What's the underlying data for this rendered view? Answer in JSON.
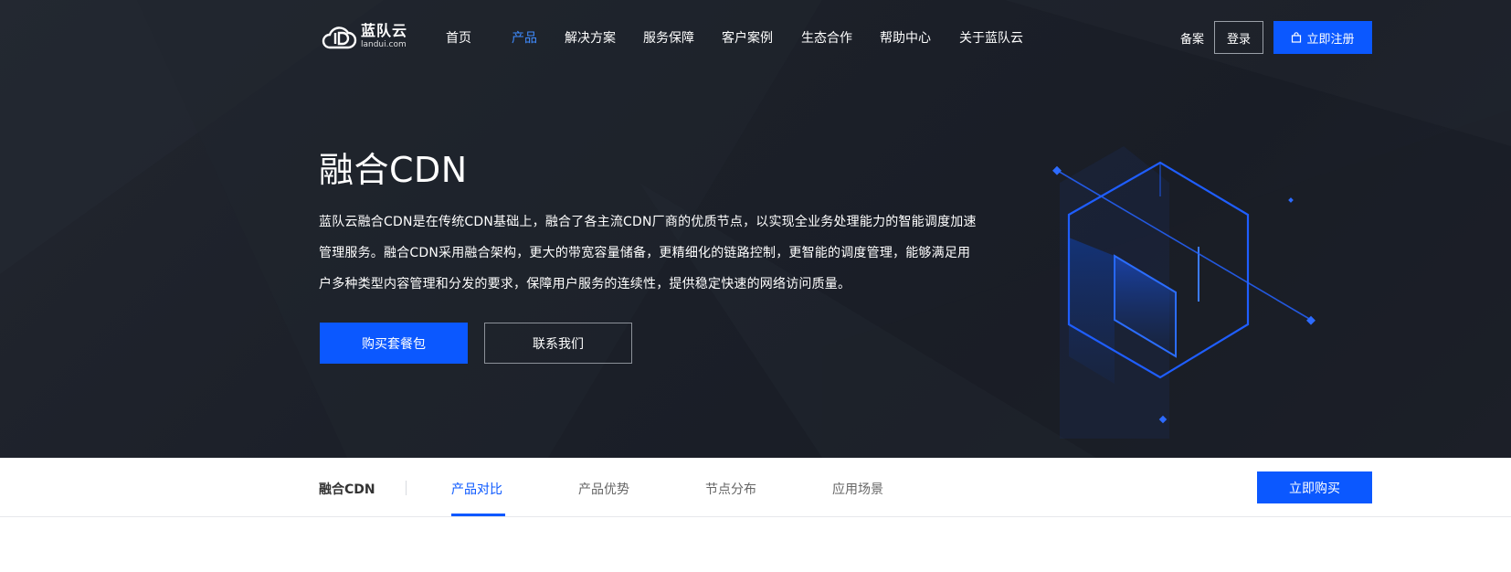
{
  "logo": {
    "name_cn": "蓝队云",
    "domain": "landui.com"
  },
  "nav": {
    "items": [
      {
        "label": "首页"
      },
      {
        "label": "产品"
      },
      {
        "label": "解决方案"
      },
      {
        "label": "服务保障"
      },
      {
        "label": "客户案例"
      },
      {
        "label": "生态合作"
      },
      {
        "label": "帮助中心"
      },
      {
        "label": "关于蓝队云"
      }
    ],
    "active_index": 1,
    "beian": "备案",
    "login": "登录",
    "register": "立即注册"
  },
  "hero": {
    "title": "融合CDN",
    "description": "蓝队云融合CDN是在传统CDN基础上，融合了各主流CDN厂商的优质节点，以实现全业务处理能力的智能调度加速管理服务。融合CDN采用融合架构，更大的带宽容量储备，更精细化的链路控制，更智能的调度管理，能够满足用户多种类型内容管理和分发的要求，保障用户服务的连续性，提供稳定快速的网络访问质量。",
    "buy_button": "购买套餐包",
    "contact_button": "联系我们"
  },
  "subnav": {
    "title": "融合CDN",
    "tabs": [
      {
        "label": "产品对比"
      },
      {
        "label": "产品优势"
      },
      {
        "label": "节点分布"
      },
      {
        "label": "应用场景"
      }
    ],
    "active_index": 0,
    "buy_now": "立即购买"
  },
  "colors": {
    "accent": "#0b58ff",
    "nav_active": "#3f8cff",
    "hero_bg": "#1d2129"
  },
  "icons": [
    "cloud-logo-icon",
    "shopping-bag-icon",
    "cube-illustration"
  ]
}
